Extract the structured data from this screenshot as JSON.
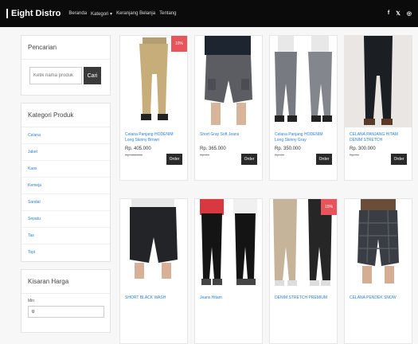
{
  "nav": {
    "brand": "Eight Distro",
    "links": [
      "Beranda",
      "Kategori ▾",
      "Keranjang Belanja",
      "Tentang"
    ],
    "social": [
      "f",
      "𝕏",
      "◎"
    ]
  },
  "sidebar": {
    "search_title": "Pencarian",
    "search_placeholder": "Ketik nama produk",
    "search_button": "Cari",
    "category_title": "Kategori Produk",
    "categories": [
      "Celana",
      "Jaket",
      "Kaos",
      "Kemeja",
      "Sandal",
      "Sepatu",
      "Tas",
      "Topi"
    ],
    "price_title": "Kisaran Harga",
    "min_label": "Min",
    "min_value": "0"
  },
  "products": [
    {
      "name": "Celana Panjang HODENIM Long Skinny Brown",
      "price": "Rp. 405.000",
      "old": "Rp. 450.000",
      "badge": "10%",
      "order": "Order"
    },
    {
      "name": "Short Gray Soft Jeans",
      "price": "Rp. 365.000",
      "old": "Rp. 0,-",
      "badge": "",
      "order": "Order"
    },
    {
      "name": "Celana Panjang HODENIM Long Skinny Gray",
      "price": "Rp. 350.000",
      "old": "Rp. 0,-",
      "badge": "",
      "order": "Order"
    },
    {
      "name": "CELANA PANJANG HITAM DENIM STRETCH",
      "price": "Rp. 300.000",
      "old": "Rp. 0,-",
      "badge": "",
      "order": "Order"
    },
    {
      "name": "SHORT BLACK WASH",
      "price": "",
      "old": "",
      "badge": "",
      "order": ""
    },
    {
      "name": "Jeans Hitam",
      "price": "",
      "old": "",
      "badge": "",
      "order": ""
    },
    {
      "name": "DENIM STRETCH PREMIUM",
      "price": "",
      "old": "",
      "badge": "15%",
      "order": ""
    },
    {
      "name": "CELANA PENDEK SNOW",
      "price": "",
      "old": "",
      "badge": "",
      "order": ""
    }
  ]
}
